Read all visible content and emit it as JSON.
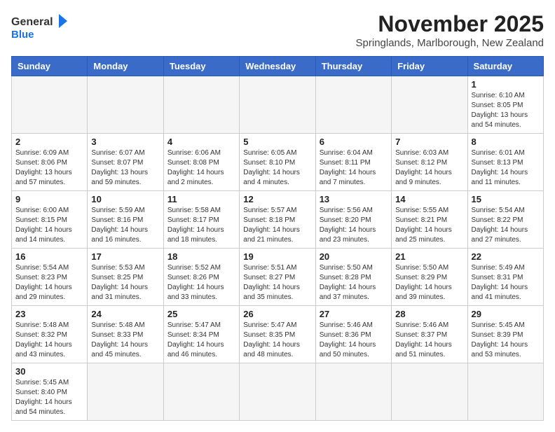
{
  "header": {
    "logo_general": "General",
    "logo_blue": "Blue",
    "month": "November 2025",
    "location": "Springlands, Marlborough, New Zealand"
  },
  "weekdays": [
    "Sunday",
    "Monday",
    "Tuesday",
    "Wednesday",
    "Thursday",
    "Friday",
    "Saturday"
  ],
  "weeks": [
    [
      {
        "day": null,
        "info": ""
      },
      {
        "day": null,
        "info": ""
      },
      {
        "day": null,
        "info": ""
      },
      {
        "day": null,
        "info": ""
      },
      {
        "day": null,
        "info": ""
      },
      {
        "day": null,
        "info": ""
      },
      {
        "day": 1,
        "info": "Sunrise: 6:10 AM\nSunset: 8:05 PM\nDaylight: 13 hours and 54 minutes."
      }
    ],
    [
      {
        "day": 2,
        "info": "Sunrise: 6:09 AM\nSunset: 8:06 PM\nDaylight: 13 hours and 57 minutes."
      },
      {
        "day": 3,
        "info": "Sunrise: 6:07 AM\nSunset: 8:07 PM\nDaylight: 13 hours and 59 minutes."
      },
      {
        "day": 4,
        "info": "Sunrise: 6:06 AM\nSunset: 8:08 PM\nDaylight: 14 hours and 2 minutes."
      },
      {
        "day": 5,
        "info": "Sunrise: 6:05 AM\nSunset: 8:10 PM\nDaylight: 14 hours and 4 minutes."
      },
      {
        "day": 6,
        "info": "Sunrise: 6:04 AM\nSunset: 8:11 PM\nDaylight: 14 hours and 7 minutes."
      },
      {
        "day": 7,
        "info": "Sunrise: 6:03 AM\nSunset: 8:12 PM\nDaylight: 14 hours and 9 minutes."
      },
      {
        "day": 8,
        "info": "Sunrise: 6:01 AM\nSunset: 8:13 PM\nDaylight: 14 hours and 11 minutes."
      }
    ],
    [
      {
        "day": 9,
        "info": "Sunrise: 6:00 AM\nSunset: 8:15 PM\nDaylight: 14 hours and 14 minutes."
      },
      {
        "day": 10,
        "info": "Sunrise: 5:59 AM\nSunset: 8:16 PM\nDaylight: 14 hours and 16 minutes."
      },
      {
        "day": 11,
        "info": "Sunrise: 5:58 AM\nSunset: 8:17 PM\nDaylight: 14 hours and 18 minutes."
      },
      {
        "day": 12,
        "info": "Sunrise: 5:57 AM\nSunset: 8:18 PM\nDaylight: 14 hours and 21 minutes."
      },
      {
        "day": 13,
        "info": "Sunrise: 5:56 AM\nSunset: 8:20 PM\nDaylight: 14 hours and 23 minutes."
      },
      {
        "day": 14,
        "info": "Sunrise: 5:55 AM\nSunset: 8:21 PM\nDaylight: 14 hours and 25 minutes."
      },
      {
        "day": 15,
        "info": "Sunrise: 5:54 AM\nSunset: 8:22 PM\nDaylight: 14 hours and 27 minutes."
      }
    ],
    [
      {
        "day": 16,
        "info": "Sunrise: 5:54 AM\nSunset: 8:23 PM\nDaylight: 14 hours and 29 minutes."
      },
      {
        "day": 17,
        "info": "Sunrise: 5:53 AM\nSunset: 8:25 PM\nDaylight: 14 hours and 31 minutes."
      },
      {
        "day": 18,
        "info": "Sunrise: 5:52 AM\nSunset: 8:26 PM\nDaylight: 14 hours and 33 minutes."
      },
      {
        "day": 19,
        "info": "Sunrise: 5:51 AM\nSunset: 8:27 PM\nDaylight: 14 hours and 35 minutes."
      },
      {
        "day": 20,
        "info": "Sunrise: 5:50 AM\nSunset: 8:28 PM\nDaylight: 14 hours and 37 minutes."
      },
      {
        "day": 21,
        "info": "Sunrise: 5:50 AM\nSunset: 8:29 PM\nDaylight: 14 hours and 39 minutes."
      },
      {
        "day": 22,
        "info": "Sunrise: 5:49 AM\nSunset: 8:31 PM\nDaylight: 14 hours and 41 minutes."
      }
    ],
    [
      {
        "day": 23,
        "info": "Sunrise: 5:48 AM\nSunset: 8:32 PM\nDaylight: 14 hours and 43 minutes."
      },
      {
        "day": 24,
        "info": "Sunrise: 5:48 AM\nSunset: 8:33 PM\nDaylight: 14 hours and 45 minutes."
      },
      {
        "day": 25,
        "info": "Sunrise: 5:47 AM\nSunset: 8:34 PM\nDaylight: 14 hours and 46 minutes."
      },
      {
        "day": 26,
        "info": "Sunrise: 5:47 AM\nSunset: 8:35 PM\nDaylight: 14 hours and 48 minutes."
      },
      {
        "day": 27,
        "info": "Sunrise: 5:46 AM\nSunset: 8:36 PM\nDaylight: 14 hours and 50 minutes."
      },
      {
        "day": 28,
        "info": "Sunrise: 5:46 AM\nSunset: 8:37 PM\nDaylight: 14 hours and 51 minutes."
      },
      {
        "day": 29,
        "info": "Sunrise: 5:45 AM\nSunset: 8:39 PM\nDaylight: 14 hours and 53 minutes."
      }
    ],
    [
      {
        "day": 30,
        "info": "Sunrise: 5:45 AM\nSunset: 8:40 PM\nDaylight: 14 hours and 54 minutes."
      },
      {
        "day": null,
        "info": ""
      },
      {
        "day": null,
        "info": ""
      },
      {
        "day": null,
        "info": ""
      },
      {
        "day": null,
        "info": ""
      },
      {
        "day": null,
        "info": ""
      },
      {
        "day": null,
        "info": ""
      }
    ]
  ]
}
